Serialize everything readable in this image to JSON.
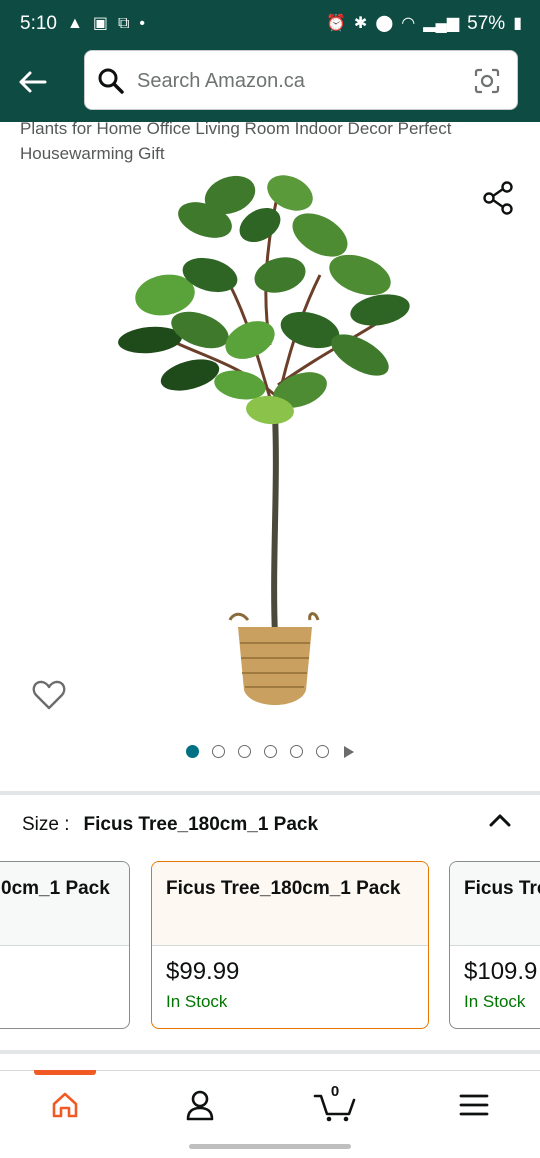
{
  "status_bar": {
    "time": "5:10",
    "battery": "57%"
  },
  "search": {
    "placeholder": "Search Amazon.ca"
  },
  "product": {
    "title": "Plants for Home Office Living Room Indoor Decor Perfect Housewarming Gift"
  },
  "gallery": {
    "image_count": 6,
    "active_index": 0
  },
  "size": {
    "label": "Size :",
    "selected_value": "Ficus Tree_180cm_1 Pack"
  },
  "options": [
    {
      "name": "0cm_1 Pack",
      "price": "",
      "stock": ""
    },
    {
      "name": "Ficus Tree_180cm_1 Pack",
      "price": "$99.99",
      "stock": "In Stock"
    },
    {
      "name": "Ficus Tre",
      "price": "$109.9",
      "stock": "In Stock"
    }
  ],
  "nav": {
    "cart_count": "0"
  },
  "colors": {
    "header_bg": "#0E4B43",
    "accent_orange": "#F15A24",
    "in_stock_green": "#007600",
    "dot_active": "#007185",
    "selected_border": "#E77600"
  }
}
